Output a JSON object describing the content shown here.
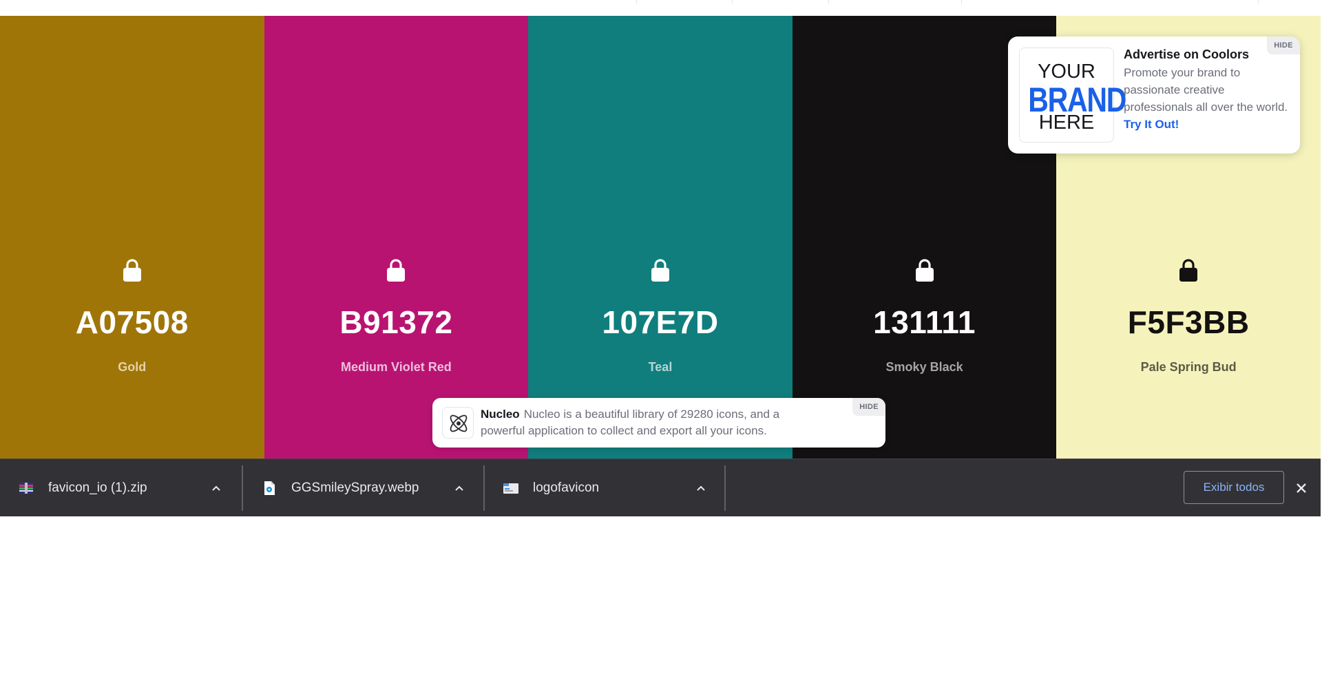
{
  "palette": {
    "swatches": [
      {
        "hex": "A07508",
        "name": "Gold",
        "bg": "#A07508",
        "hex_color": "#ffffff",
        "name_color": "#e6d3a8",
        "lock_color": "#ffffff"
      },
      {
        "hex": "B91372",
        "name": "Medium Violet Red",
        "bg": "#B91372",
        "hex_color": "#ffffff",
        "name_color": "#edc0db",
        "lock_color": "#ffffff"
      },
      {
        "hex": "107E7D",
        "name": "Teal",
        "bg": "#107E7D",
        "hex_color": "#ffffff",
        "name_color": "#b5d6d6",
        "lock_color": "#ffffff"
      },
      {
        "hex": "131111",
        "name": "Smoky Black",
        "bg": "#131111",
        "hex_color": "#ffffff",
        "name_color": "#a6a6a6",
        "lock_color": "#ffffff"
      },
      {
        "hex": "F5F3BB",
        "name": "Pale Spring Bud",
        "bg": "#F5F3BB",
        "hex_color": "#131111",
        "name_color": "#5c5b47",
        "lock_color": "#131111"
      }
    ]
  },
  "ad": {
    "hide_label": "HIDE",
    "brand_line1": "YOUR",
    "brand_line2": "BRAND",
    "brand_line3": "HERE",
    "title": "Advertise on Coolors",
    "body": "Promote your brand to passionate creative professionals all over the world.",
    "link_label": "Try It Out!"
  },
  "nucleo": {
    "hide_label": "HIDE",
    "title": "Nucleo",
    "body": "Nucleo is a beautiful library of 29280 icons, and a powerful application to collect and export all your icons."
  },
  "downloads": {
    "items": [
      {
        "name": "favicon_io (1).zip",
        "icon": "zip-archive-icon"
      },
      {
        "name": "GGSmileySpray.webp",
        "icon": "image-file-icon"
      },
      {
        "name": "logofavicon",
        "icon": "folder-window-icon"
      }
    ],
    "show_all_label": "Exibir todos",
    "close_icon": "close-icon"
  },
  "colors": {
    "accent_blue": "#1a60e8",
    "download_bar": "#323236",
    "link_blue": "#8ab4f8"
  }
}
